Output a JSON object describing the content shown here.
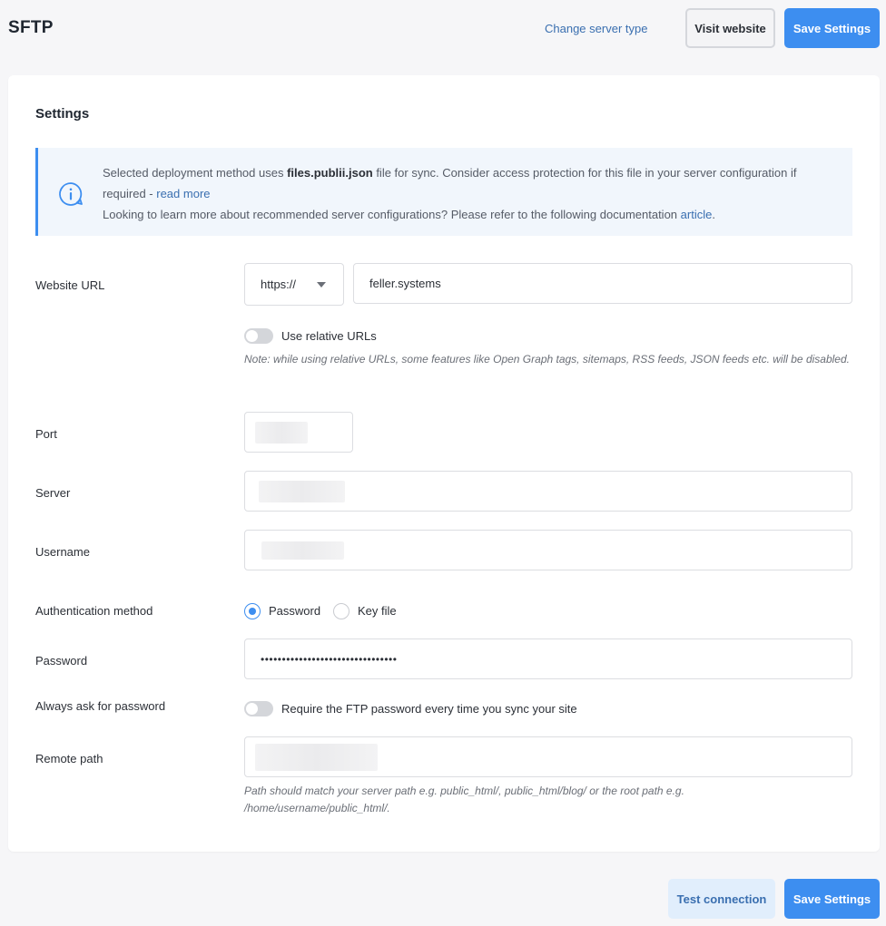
{
  "header": {
    "title": "SFTP",
    "change_server_type": "Change server type",
    "visit_website": "Visit website",
    "save_settings": "Save Settings"
  },
  "settings": {
    "title": "Settings",
    "info": {
      "line1_prefix": "Selected deployment method uses ",
      "line1_file": "files.publii.json",
      "line1_suffix": " file for sync. Consider access protection for this file in your server configuration if required - ",
      "read_more": "read more",
      "line2": "Looking to learn more about recommended server configurations? Please refer to the following documentation ",
      "article": "article",
      "line2_end": "."
    },
    "website_url": {
      "label": "Website URL",
      "protocol": "https://",
      "value": "feller.systems"
    },
    "relative_urls": {
      "label": "Use relative URLs",
      "enabled": false,
      "note": "Note: while using relative URLs, some features like Open Graph tags, sitemaps, RSS feeds, JSON feeds etc. will be disabled."
    },
    "port": {
      "label": "Port"
    },
    "server": {
      "label": "Server"
    },
    "username": {
      "label": "Username"
    },
    "auth": {
      "label": "Authentication method",
      "options": [
        "Password",
        "Key file"
      ],
      "selected": "Password"
    },
    "password": {
      "label": "Password",
      "value": "••••••••••••••••••••••••••••••••"
    },
    "always_ask": {
      "label": "Always ask for password",
      "toggle_label": "Require the FTP password every time you sync your site",
      "enabled": false
    },
    "remote_path": {
      "label": "Remote path",
      "note": "Path should match your server path e.g. public_html/, public_html/blog/ or the root path e.g. /home/username/public_html/."
    }
  },
  "footer": {
    "test_connection": "Test connection",
    "save_settings": "Save Settings"
  },
  "colors": {
    "accent": "#3d8ef0",
    "link": "#3a6fb0",
    "info_bg": "#f1f6fc"
  }
}
